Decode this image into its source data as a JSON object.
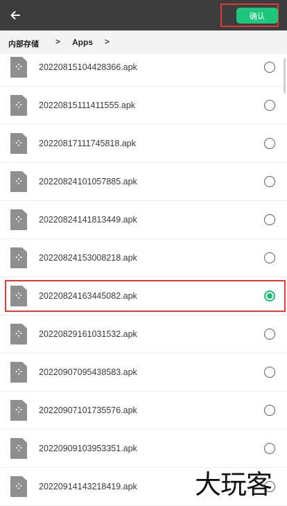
{
  "topbar": {
    "back_icon": "arrow-left-icon",
    "confirm_label": "确认",
    "confirm_color": "#1fc77e"
  },
  "breadcrumb": {
    "items": [
      "内部存储",
      "Apps"
    ],
    "separator": ">"
  },
  "files": [
    {
      "name": "20220815104428366.apk",
      "selected": false
    },
    {
      "name": "20220815111411555.apk",
      "selected": false
    },
    {
      "name": "20220817111745818.apk",
      "selected": false
    },
    {
      "name": "20220824101057885.apk",
      "selected": false
    },
    {
      "name": "20220824141813449.apk",
      "selected": false
    },
    {
      "name": "20220824153008218.apk",
      "selected": false
    },
    {
      "name": "20220824163445082.apk",
      "selected": true
    },
    {
      "name": "20220829161031532.apk",
      "selected": false
    },
    {
      "name": "20220907095438583.apk",
      "selected": false
    },
    {
      "name": "20220907101735576.apk",
      "selected": false
    },
    {
      "name": "20220909103953351.apk",
      "selected": false
    },
    {
      "name": "20220914143218419.apk",
      "selected": false
    }
  ],
  "watermark": "大玩客",
  "colors": {
    "highlight": "#e03a3a",
    "topbar": "#3d3d3d",
    "selected": "#1fb877"
  }
}
